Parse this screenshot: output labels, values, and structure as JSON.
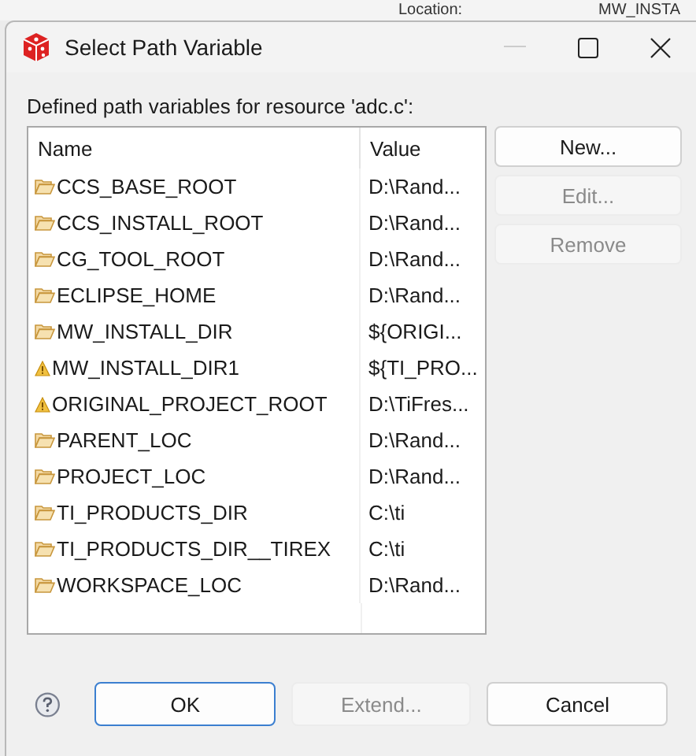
{
  "background": {
    "texts": [
      "Location:",
      "MW_INSTA"
    ]
  },
  "window": {
    "title": "Select Path Variable"
  },
  "prompt": "Defined path variables for resource 'adc.c':",
  "table": {
    "columns": [
      "Name",
      "Value"
    ],
    "rows": [
      {
        "kind": "folder",
        "name": "CCS_BASE_ROOT",
        "value": "D:\\Rand..."
      },
      {
        "kind": "folder",
        "name": "CCS_INSTALL_ROOT",
        "value": "D:\\Rand..."
      },
      {
        "kind": "folder",
        "name": "CG_TOOL_ROOT",
        "value": "D:\\Rand..."
      },
      {
        "kind": "folder",
        "name": "ECLIPSE_HOME",
        "value": "D:\\Rand..."
      },
      {
        "kind": "folder",
        "name": "MW_INSTALL_DIR",
        "value": "${ORIGI..."
      },
      {
        "kind": "warning",
        "name": "MW_INSTALL_DIR1",
        "value": "${TI_PRO..."
      },
      {
        "kind": "warning",
        "name": "ORIGINAL_PROJECT_ROOT",
        "value": "D:\\TiFres..."
      },
      {
        "kind": "folder",
        "name": "PARENT_LOC",
        "value": "D:\\Rand..."
      },
      {
        "kind": "folder",
        "name": "PROJECT_LOC",
        "value": "D:\\Rand..."
      },
      {
        "kind": "folder",
        "name": "TI_PRODUCTS_DIR",
        "value": "C:\\ti"
      },
      {
        "kind": "folder",
        "name": "TI_PRODUCTS_DIR__TIREX",
        "value": "C:\\ti"
      },
      {
        "kind": "folder",
        "name": "WORKSPACE_LOC",
        "value": "D:\\Rand..."
      }
    ]
  },
  "side_buttons": [
    {
      "label": "New...",
      "disabled": false
    },
    {
      "label": "Edit...",
      "disabled": true
    },
    {
      "label": "Remove",
      "disabled": true
    }
  ],
  "bottom_buttons": [
    {
      "label": "OK",
      "disabled": false,
      "default": true
    },
    {
      "label": "Extend...",
      "disabled": true,
      "default": false
    },
    {
      "label": "Cancel",
      "disabled": false,
      "default": false
    }
  ]
}
